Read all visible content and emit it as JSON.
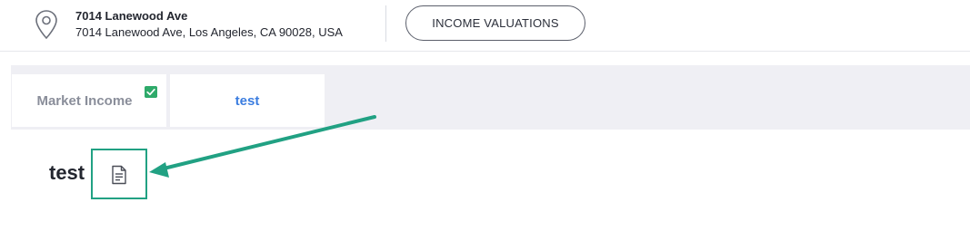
{
  "header": {
    "address_title": "7014 Lanewood Ave",
    "address_full": "7014 Lanewood Ave, Los Angeles, CA 90028, USA",
    "valuations_button": "INCOME VALUATIONS",
    "location_icon": "map-pin-icon"
  },
  "tabs": [
    {
      "label": "Market Income",
      "status_icon": "checkbox-checked-icon",
      "active": false
    },
    {
      "label": "test",
      "active": true
    }
  ],
  "content": {
    "title": "test",
    "document_icon": "document-icon"
  },
  "annotation": {
    "color": "#21a183"
  },
  "colors": {
    "active_tab": "#3b7de0",
    "inactive_tab": "#8a8e9a",
    "check": "#2eaa6a",
    "tab_bar_bg": "#efeff4"
  }
}
